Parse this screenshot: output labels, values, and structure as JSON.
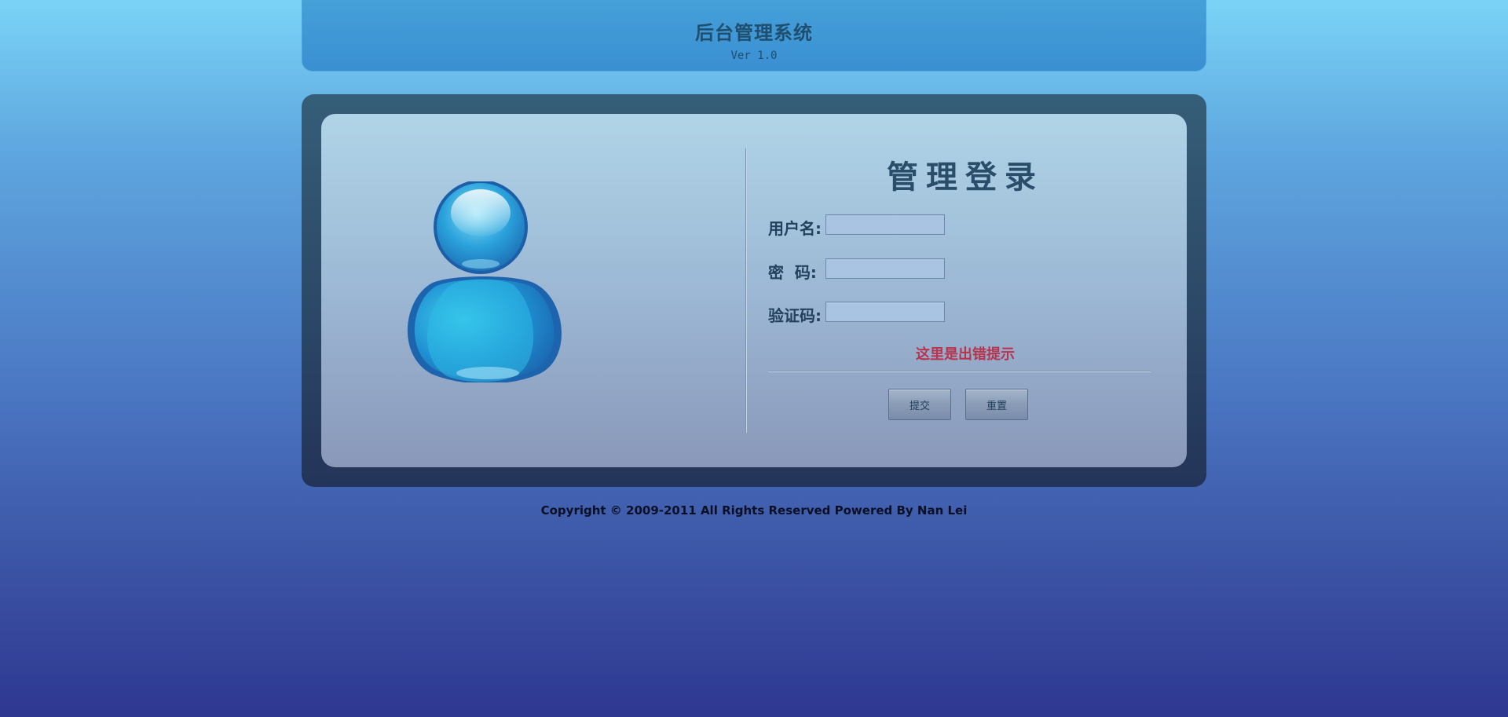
{
  "header": {
    "title": "后台管理系统",
    "version": "Ver 1.0"
  },
  "login": {
    "title": "管理登录",
    "fields": [
      {
        "label": "用户名:",
        "value": "",
        "placeholder": ""
      },
      {
        "label": "密  码:",
        "value": "",
        "placeholder": ""
      },
      {
        "label": "验证码:",
        "value": "",
        "placeholder": ""
      }
    ],
    "error_message": "这里是出错提示",
    "submit_label": "提交",
    "reset_label": "重置"
  },
  "footer": {
    "copyright": "Copyright © 2009-2011 All Rights Reserved Powered By Nan Lei"
  },
  "icons": {
    "avatar": "user-avatar-icon"
  },
  "colors": {
    "error": "#b8334d",
    "title": "#2a4e6a",
    "header_bg": "#3a8fd2"
  }
}
